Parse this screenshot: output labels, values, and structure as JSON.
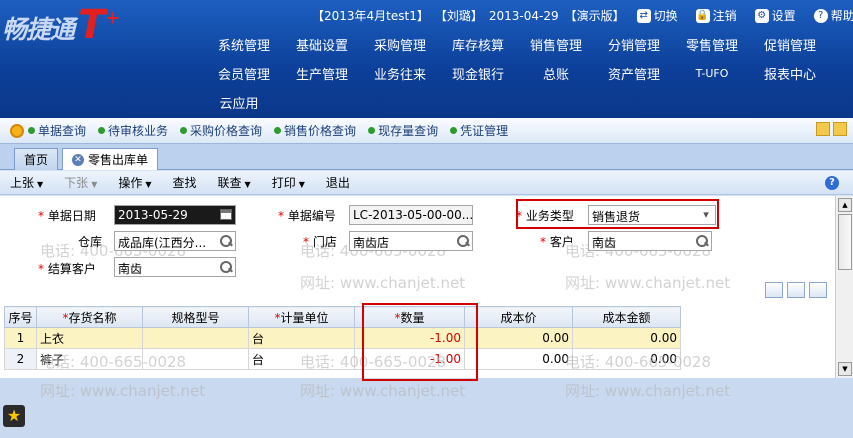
{
  "app": {
    "logo_text": "畅捷通",
    "logo_suffix": "T",
    "logo_plus": "+"
  },
  "header": {
    "period": "【2013年4月test1】",
    "user": "【刘璐】",
    "date": "2013-04-29",
    "mode": "【演示版】",
    "links": [
      {
        "label": "切换",
        "icon": "switch-icon"
      },
      {
        "label": "注销",
        "icon": "lock-icon"
      },
      {
        "label": "设置",
        "icon": "settings-icon"
      },
      {
        "label": "帮助",
        "icon": "help-icon"
      }
    ]
  },
  "main_menu": {
    "row1": [
      "系统管理",
      "基础设置",
      "采购管理",
      "库存核算",
      "销售管理",
      "分销管理",
      "零售管理",
      "促销管理"
    ],
    "row2": [
      "会员管理",
      "生产管理",
      "业务往来",
      "现金银行",
      "总账",
      "资产管理",
      "T-UFO",
      "报表中心"
    ],
    "row3": [
      "云应用"
    ]
  },
  "quick_links": [
    "单据查询",
    "待审核业务",
    "采购价格查询",
    "销售价格查询",
    "现存量查询",
    "凭证管理"
  ],
  "tabs": [
    {
      "label": "首页",
      "active": false
    },
    {
      "label": "零售出库单",
      "active": true
    }
  ],
  "toolbar": {
    "items": [
      {
        "label": "上张",
        "dropdown": true,
        "disabled": false
      },
      {
        "label": "下张",
        "dropdown": true,
        "disabled": true
      },
      {
        "label": "操作",
        "dropdown": true,
        "disabled": false
      },
      {
        "label": "查找",
        "dropdown": false,
        "disabled": false
      },
      {
        "label": "联查",
        "dropdown": true,
        "disabled": false
      },
      {
        "label": "打印",
        "dropdown": true,
        "disabled": false
      },
      {
        "label": "退出",
        "dropdown": false,
        "disabled": false
      }
    ]
  },
  "form": {
    "date_label": "单据日期",
    "date_value": "2013-05-29",
    "doc_no_label": "单据编号",
    "doc_no_value": "LC-2013-05-00-00...",
    "biz_type_label": "业务类型",
    "biz_type_value": "销售退货",
    "warehouse_label": "仓库",
    "warehouse_value": "成品库(江西分...",
    "store_label": "门店",
    "store_value": "南齿店",
    "customer_label": "客户",
    "customer_value": "南齿",
    "settle_label": "结算客户",
    "settle_value": "南齿"
  },
  "watermark": {
    "phone": "电话: 400-665-0028",
    "site": "网址: www.chanjet.net"
  },
  "grid": {
    "columns": [
      {
        "label": "序号",
        "required": false
      },
      {
        "label": "存货名称",
        "required": true
      },
      {
        "label": "规格型号",
        "required": false
      },
      {
        "label": "计量单位",
        "required": true
      },
      {
        "label": "数量",
        "required": true
      },
      {
        "label": "成本价",
        "required": false
      },
      {
        "label": "成本金额",
        "required": false
      }
    ],
    "rows": [
      {
        "idx": "1",
        "name": "上衣",
        "spec": "",
        "unit": "台",
        "qty": "-1.00",
        "price": "0.00",
        "amount": "0.00"
      },
      {
        "idx": "2",
        "name": "裤子",
        "spec": "",
        "unit": "台",
        "qty": "-1.00",
        "price": "0.00",
        "amount": "0.00"
      }
    ]
  },
  "colors": {
    "header_bg": "#0c3f99",
    "highlight_box": "#d40000",
    "negative": "#d00000",
    "selected_row": "#fcf3c2"
  }
}
